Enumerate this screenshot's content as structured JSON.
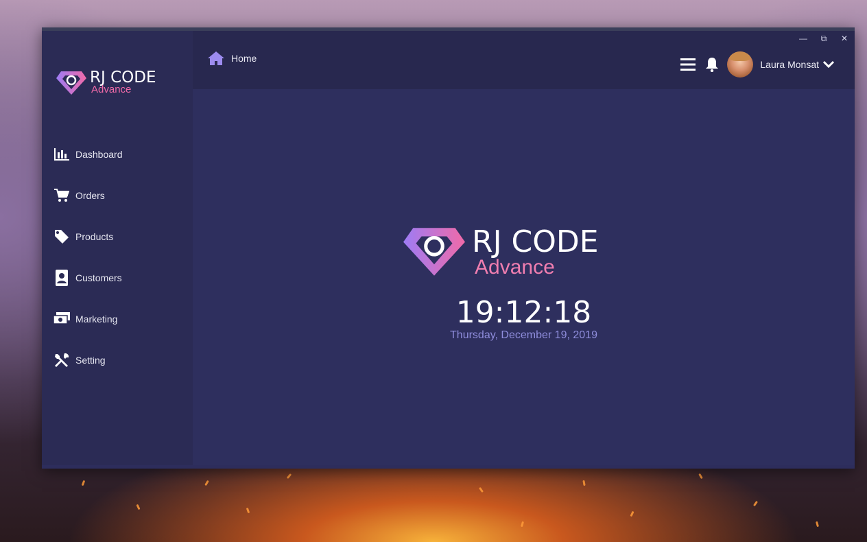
{
  "app": {
    "brand_main": "RJ CODE",
    "brand_sub": "Advance"
  },
  "window_controls": {
    "minimize": "—",
    "maximize": "⧉",
    "close": "✕"
  },
  "sidebar": {
    "items": [
      {
        "label": "Dashboard",
        "icon": "bar-chart-icon"
      },
      {
        "label": "Orders",
        "icon": "shopping-cart-icon"
      },
      {
        "label": "Products",
        "icon": "tag-icon"
      },
      {
        "label": "Customers",
        "icon": "address-book-icon"
      },
      {
        "label": "Marketing",
        "icon": "money-icon"
      },
      {
        "label": "Setting",
        "icon": "tools-icon"
      }
    ]
  },
  "header": {
    "breadcrumb": "Home",
    "user_name": "Laura Monsat"
  },
  "main": {
    "brand_main": "RJ CODE",
    "brand_sub": "Advance",
    "time": "19:12:18",
    "date": "Thursday, December 19, 2019"
  },
  "colors": {
    "sidebar_bg": "#2b2b55",
    "content_bg": "#2e2f5e",
    "accent_pink": "#f06aa8",
    "accent_purple": "#9d8cf0"
  }
}
